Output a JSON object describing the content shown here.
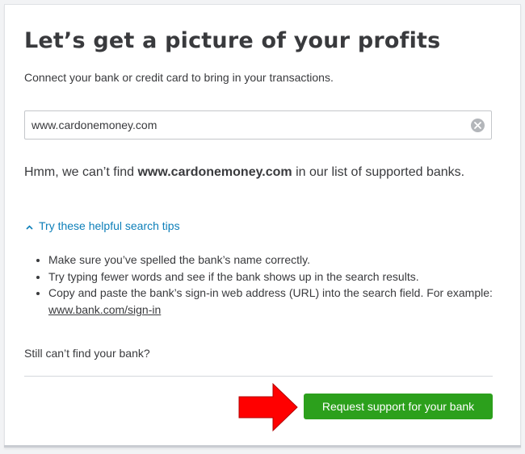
{
  "title": "Let’s get a picture of your profits",
  "subtitle": "Connect your bank or credit card to bring in your transactions.",
  "search": {
    "value": "www.cardonemoney.com",
    "clear_icon": "clear-icon"
  },
  "not_found": {
    "prefix": "Hmm, we can’t find ",
    "bank": "www.cardonemoney.com",
    "suffix": " in our list of supported banks."
  },
  "tips": {
    "toggle_label": "Try these helpful search tips",
    "toggle_icon": "chevron-up-icon",
    "items": [
      "Make sure you’ve spelled the bank’s name correctly.",
      "Try typing fewer words and see if the bank shows up in the search results."
    ],
    "item3_text": "Copy and paste the bank’s sign-in web address (URL) into the search field. For example: ",
    "item3_link": "www.bank.com/sign-in"
  },
  "still_cant_find": "Still can’t find your bank?",
  "cta_label": "Request support for your bank",
  "colors": {
    "accent": "#0d7fb9",
    "button": "#2ca01c",
    "arrow": "#ff0000"
  }
}
